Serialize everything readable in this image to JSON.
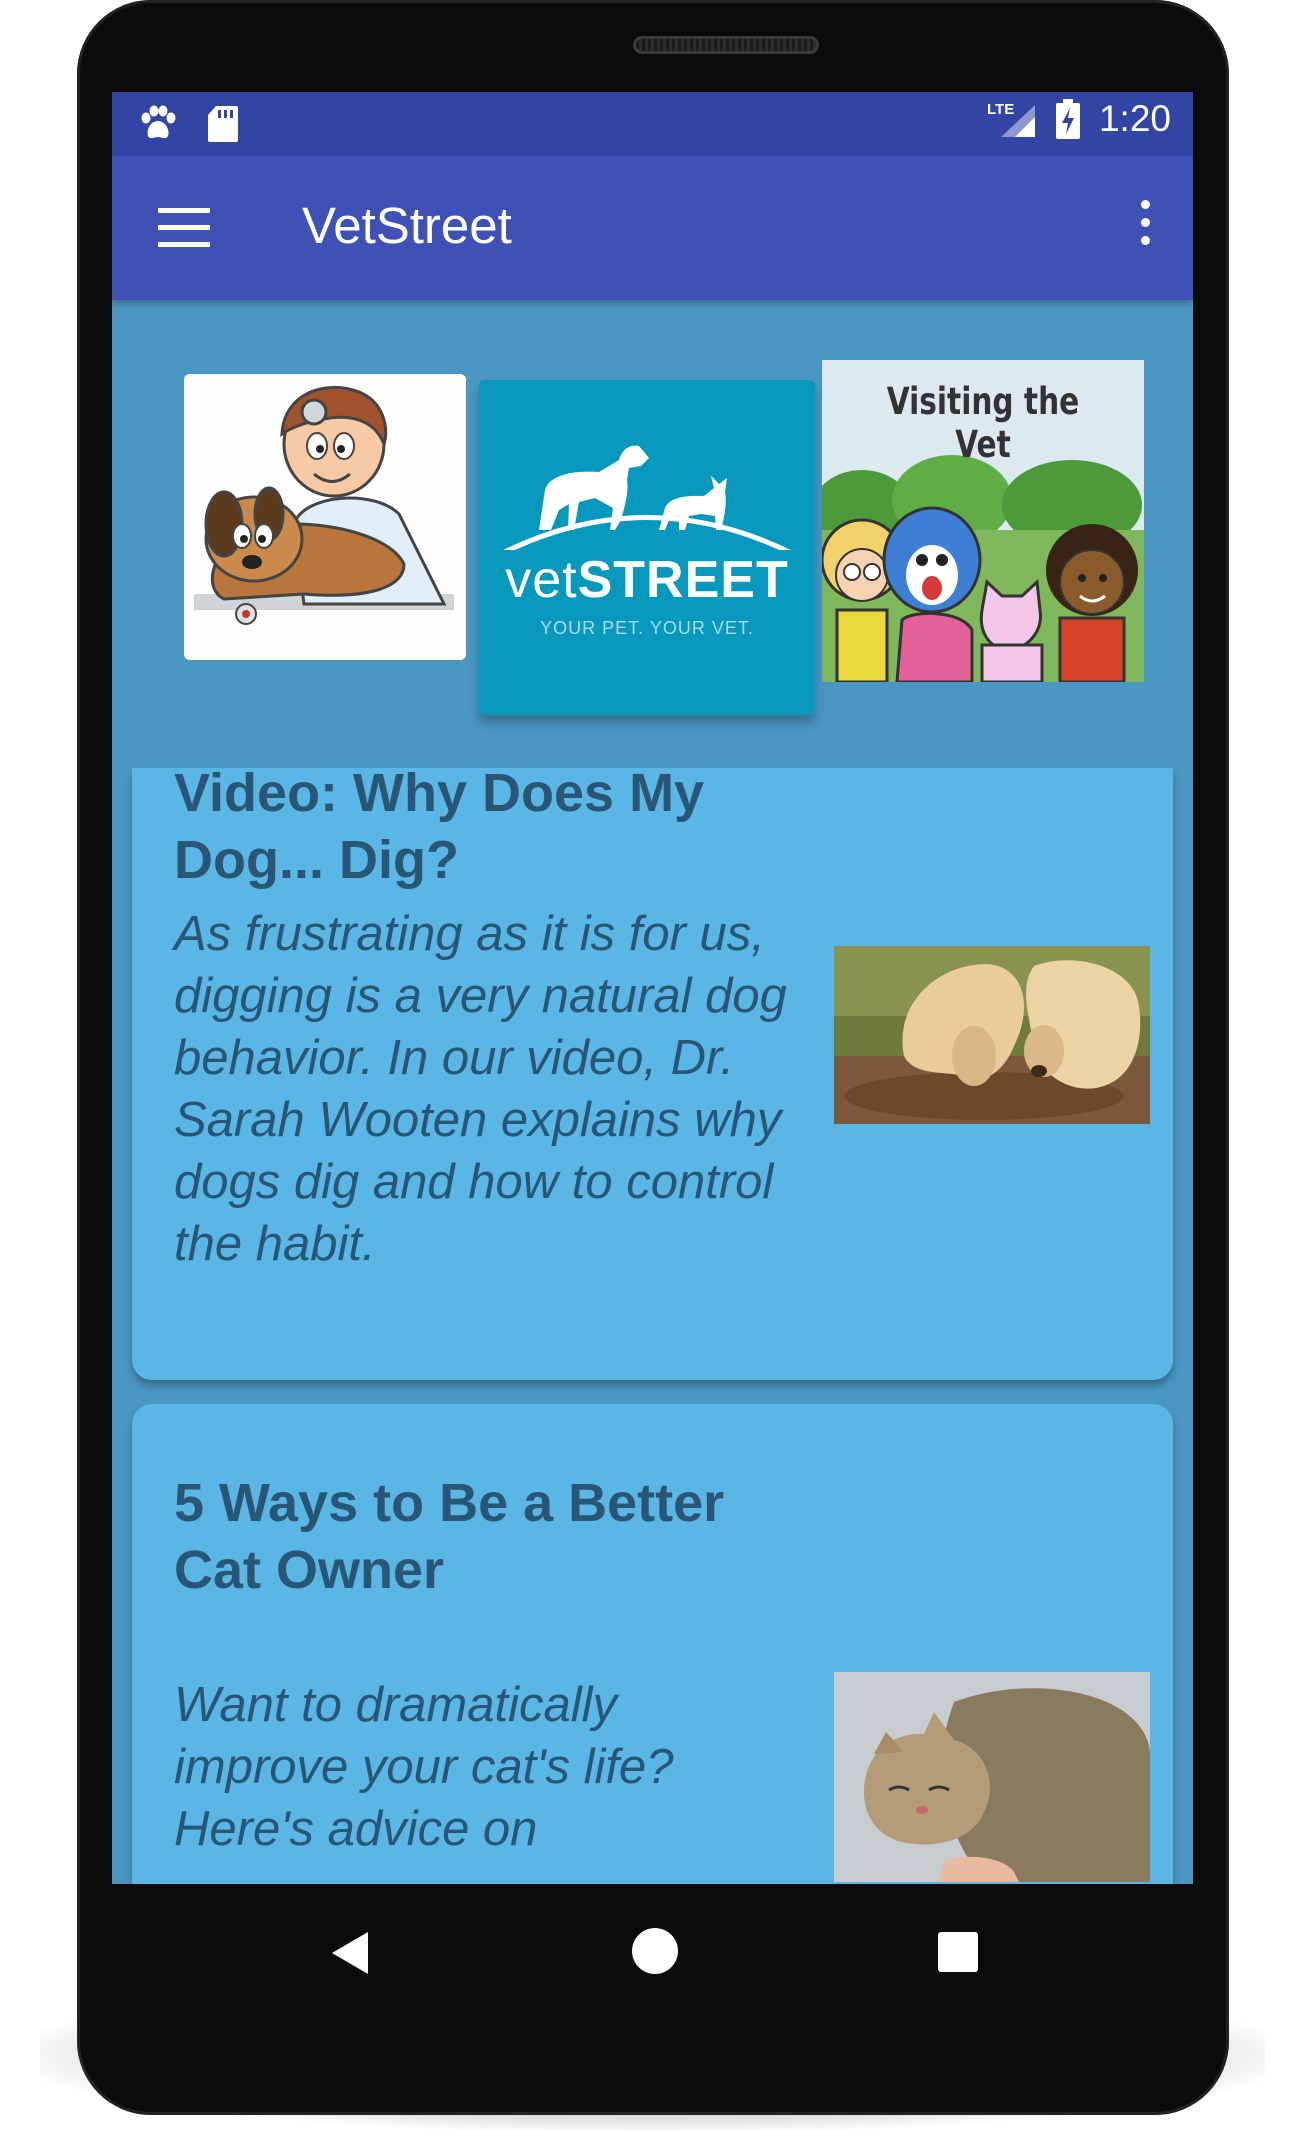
{
  "status_bar": {
    "network": "LTE",
    "time": "1:20"
  },
  "app_bar": {
    "title": "VetStreet"
  },
  "banner": {
    "logo": {
      "brand_light": "vet",
      "brand_bold": "STREET",
      "tagline": "YOUR PET. YOUR VET."
    },
    "visiting_title": "Visiting the Vet"
  },
  "articles": [
    {
      "title": "Video: Why Does My Dog... Dig?",
      "description": "As frustrating as it is for us, digging is a very natural dog behavior. In our video, Dr. Sarah Wooten explains why dogs dig and how to control the habit."
    },
    {
      "title": "5 Ways to Be a Better Cat Owner",
      "description": "Want to dramatically improve your cat's life? Here's advice on"
    }
  ],
  "colors": {
    "status_bar": "#3244a4",
    "app_bar": "#3f51b5",
    "background": "#4a97c3",
    "card": "#5ab6e4",
    "card_text": "#2a5675",
    "logo_tile": "#0799bd"
  }
}
